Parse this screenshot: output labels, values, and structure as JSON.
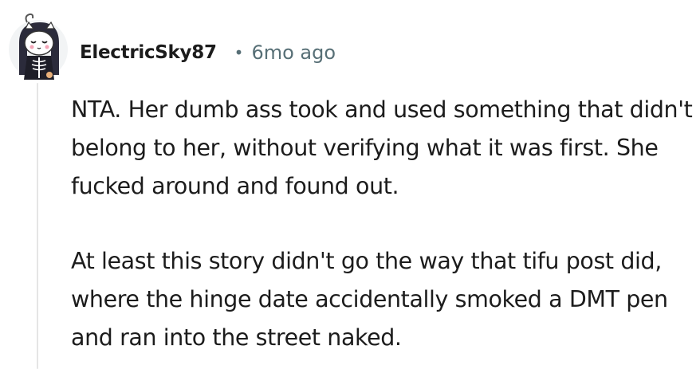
{
  "comment": {
    "author": "ElectricSky87",
    "separator": "•",
    "timestamp": "6mo ago",
    "avatar_icon": "cartoon-skeleton-avatar-icon",
    "body_paragraphs": [
      "NTA. Her dumb ass took and used something that didn't belong to her, without verifying what it was first. She fucked around and found out.",
      "At least this story didn't go the way that tifu post did, where the hinge date accidentally smoked a DMT pen and ran into the street naked."
    ]
  },
  "colors": {
    "text": "#1c1c1c",
    "meta": "#576f76",
    "thread_line": "#e5e5e5",
    "avatar_bg": "#f2f4f5"
  }
}
